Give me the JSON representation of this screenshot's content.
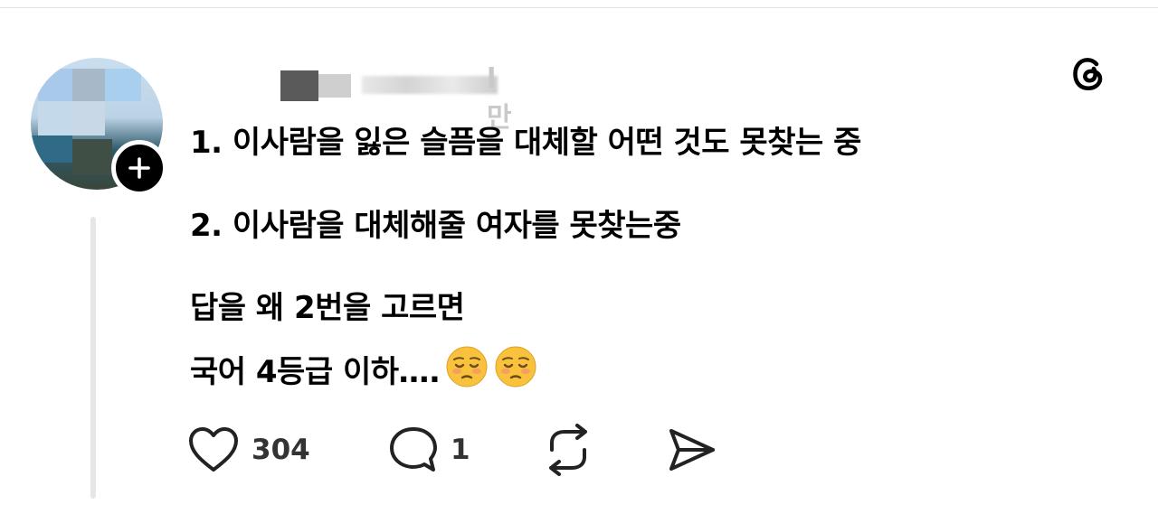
{
  "post": {
    "username_visible_fragment": "l만",
    "lines": [
      "1. 이사람을 잃은 슬픔을 대체할 어떤 것도 못찾는 중",
      "2. 이사람을 대체해줄 여자를 못찾는중",
      "답을 왜 2번을 고르면",
      "국어 4등급 이하…."
    ],
    "emojis": [
      "pensive-face",
      "pensive-face"
    ]
  },
  "actions": {
    "like_count": "304",
    "reply_count": "1"
  },
  "icons": {
    "app_logo": "threads-logo-icon",
    "like": "heart-icon",
    "reply": "comment-bubble-icon",
    "repost": "repost-icon",
    "share": "send-icon",
    "follow": "plus-icon"
  },
  "colors": {
    "text": "#000000",
    "icon": "#222222",
    "thread_line": "#e6e6e6",
    "count": "#333333"
  }
}
